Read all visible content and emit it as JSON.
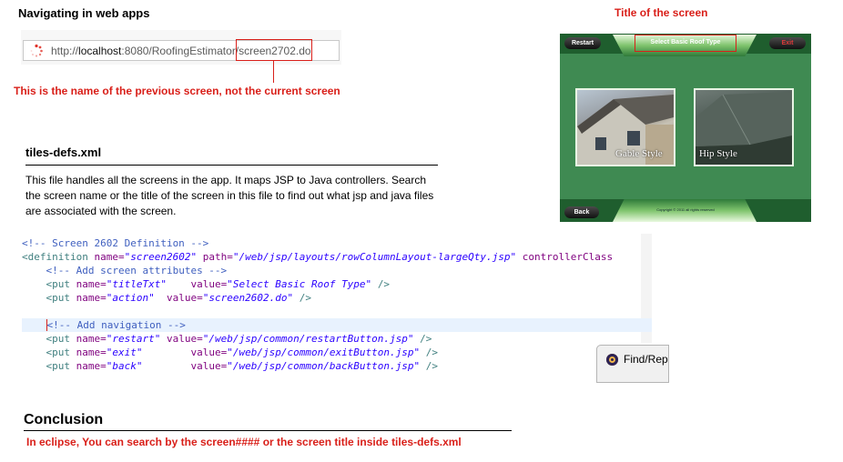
{
  "nav_section": {
    "heading": "Navigating in web apps",
    "url_prefix": "http://",
    "url_host": "localhost",
    "url_rest": ":8080/RoofingEstimator/",
    "url_screen": "screen2702.do",
    "callout": "This is the name of the previous screen, not the current screen"
  },
  "title_callout": "Title of the screen",
  "app_screen": {
    "restart_label": "Restart",
    "exit_label": "Exit",
    "title": "Select Basic Roof Type",
    "back_label": "Back",
    "copyright": "Copyright © 2011 all rights reserved",
    "options": [
      {
        "label": "Gable Style"
      },
      {
        "label": "Hip Style"
      }
    ],
    "colors": {
      "background": "#3f8a52",
      "callout": "#d9201a"
    }
  },
  "tiles_section": {
    "heading": "tiles-defs.xml",
    "description": "This file handles all the screens in the app. It maps JSP to Java controllers. Search the screen name or the title of the screen in this file to find out what jsp and java files are associated with the screen."
  },
  "code": {
    "comment1": "<!-- Screen 2602 Definition -->",
    "def_open": "<definition",
    "def_name_attr": "name=",
    "def_name_val": "\"screen2602\"",
    "def_path_attr": "path=",
    "def_path_val": "\"/web/jsp/layouts/rowColumnLayout-largeQty.jsp\"",
    "def_ctrl_attr": "controllerClass",
    "comment2": "<!-- Add screen attributes -->",
    "put1_name": "\"titleTxt\"",
    "put1_value": "\"Select Basic Roof Type\"",
    "put2_name": "\"action\"",
    "put2_value": "\"screen2602.do\"",
    "comment3": "<!-- Add navigation -->",
    "put3_name": "\"restart\"",
    "put3_value": "\"/web/jsp/common/restartButton.jsp\"",
    "put4_name": "\"exit\"",
    "put4_value": "\"/web/jsp/common/exitButton.jsp\"",
    "put5_name": "\"back\"",
    "put5_value": "\"/web/jsp/common/backButton.jsp\"",
    "put_tag": "<put",
    "name_attr": "name=",
    "value_attr": "value=",
    "close": "/>",
    "find_dialog_title": "Find/Rep"
  },
  "conclusion": {
    "heading": "Conclusion",
    "text": "In eclipse, You can search by the screen#### or the screen title inside tiles-defs.xml"
  }
}
